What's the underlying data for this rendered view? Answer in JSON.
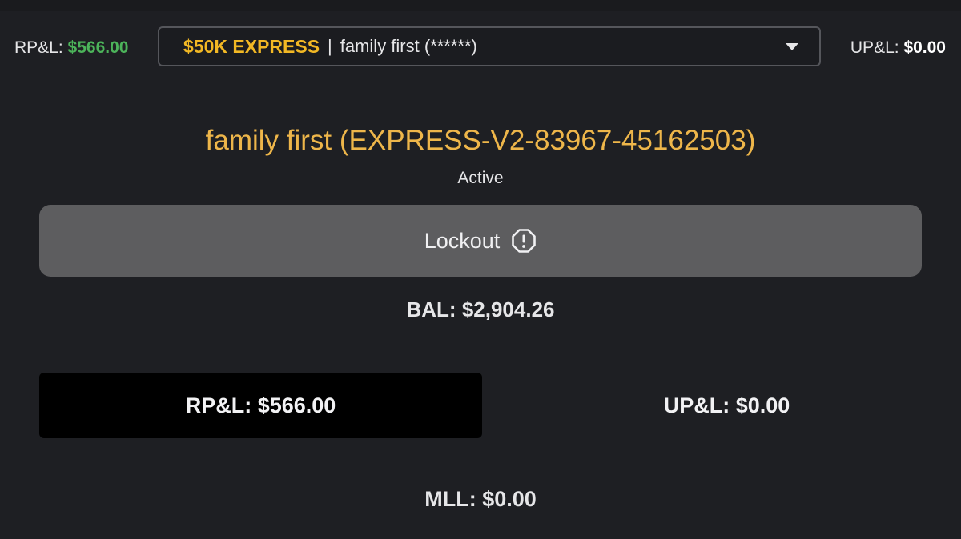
{
  "header": {
    "rpl_label": "RP&L:",
    "rpl_value": "$566.00",
    "upl_label": "UP&L:",
    "upl_value": "$0.00",
    "account_select": {
      "plan": "$50K EXPRESS",
      "separator": "|",
      "account_name": "family first (******)"
    }
  },
  "account": {
    "title": "family first (EXPRESS-V2-83967-45162503)",
    "status": "Active"
  },
  "lockout": {
    "label": "Lockout",
    "icon": "alert-octagon-icon"
  },
  "balance": {
    "text": "BAL: $2,904.26"
  },
  "pnl": {
    "rpl_text": "RP&L: $566.00",
    "upl_text": "UP&L: $0.00"
  },
  "mll": {
    "text": "MLL: $0.00"
  },
  "colors": {
    "background": "#1e1f23",
    "accent_gold": "#eeb64a",
    "plan_yellow": "#f2b824",
    "profit_green": "#4cb35a",
    "lockout_gray": "#5d5d5f"
  }
}
